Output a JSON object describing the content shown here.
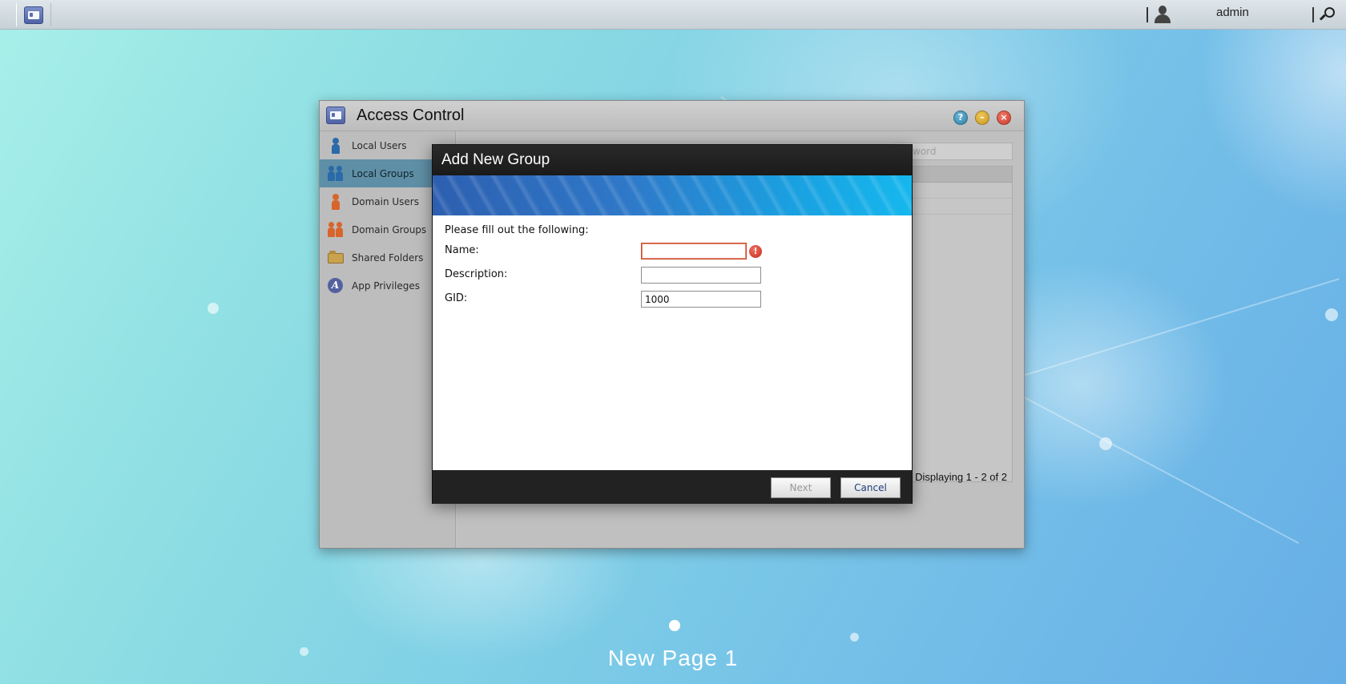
{
  "topbar": {
    "username": "admin"
  },
  "window": {
    "title": "Access Control",
    "help_glyph": "?",
    "sidebar": {
      "items": [
        {
          "label": "Local Users",
          "icon": "user-icon"
        },
        {
          "label": "Local Groups",
          "icon": "group-icon",
          "active": true
        },
        {
          "label": "Domain Users",
          "icon": "domain-user-icon"
        },
        {
          "label": "Domain Groups",
          "icon": "domain-group-icon"
        },
        {
          "label": "Shared Folders",
          "icon": "folder-icon"
        },
        {
          "label": "App Privileges",
          "icon": "app-privileges-icon"
        }
      ]
    },
    "content": {
      "search_placeholder": "word",
      "displaying": "Displaying 1 - 2 of 2"
    }
  },
  "modal": {
    "title": "Add New Group",
    "intro": "Please fill out the following:",
    "fields": {
      "name": {
        "label": "Name:",
        "value": ""
      },
      "description": {
        "label": "Description:",
        "value": ""
      },
      "gid": {
        "label": "GID:",
        "value": "1000"
      }
    },
    "error_glyph": "!",
    "buttons": {
      "next": "Next",
      "cancel": "Cancel"
    }
  },
  "desktop": {
    "page_name": "New Page 1"
  },
  "colors": {
    "active_sidebar": "#5f8fa6",
    "error": "#c62c1c",
    "modal_dark": "#222222"
  }
}
